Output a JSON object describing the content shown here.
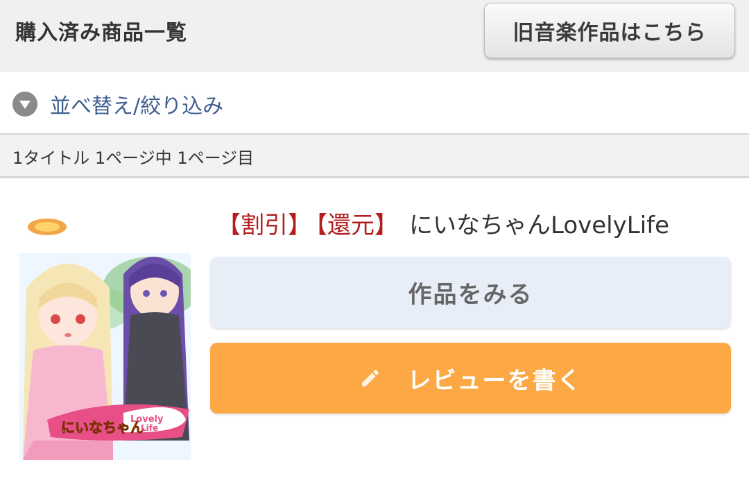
{
  "header": {
    "title": "購入済み商品一覧",
    "old_music_button": "旧音楽作品はこちら"
  },
  "filter": {
    "label": "並べ替え/絞り込み",
    "icon": "triangle-down-icon"
  },
  "pagination": {
    "summary": "1タイトル 1ページ中 1ページ目"
  },
  "item": {
    "tags": [
      "【割引】",
      "【還元】"
    ],
    "title": "にいなちゃんLovelyLife",
    "view_button": "作品をみる",
    "review_button": "レビューを書く",
    "review_icon": "pencil-icon",
    "thumbnail_logo_text": "にいなちゃん Lovely Life"
  },
  "colors": {
    "tag_red": "#b31d1d",
    "link_blue": "#3f5f8f",
    "review_orange": "#fca844",
    "view_blue": "#e8eef8"
  }
}
